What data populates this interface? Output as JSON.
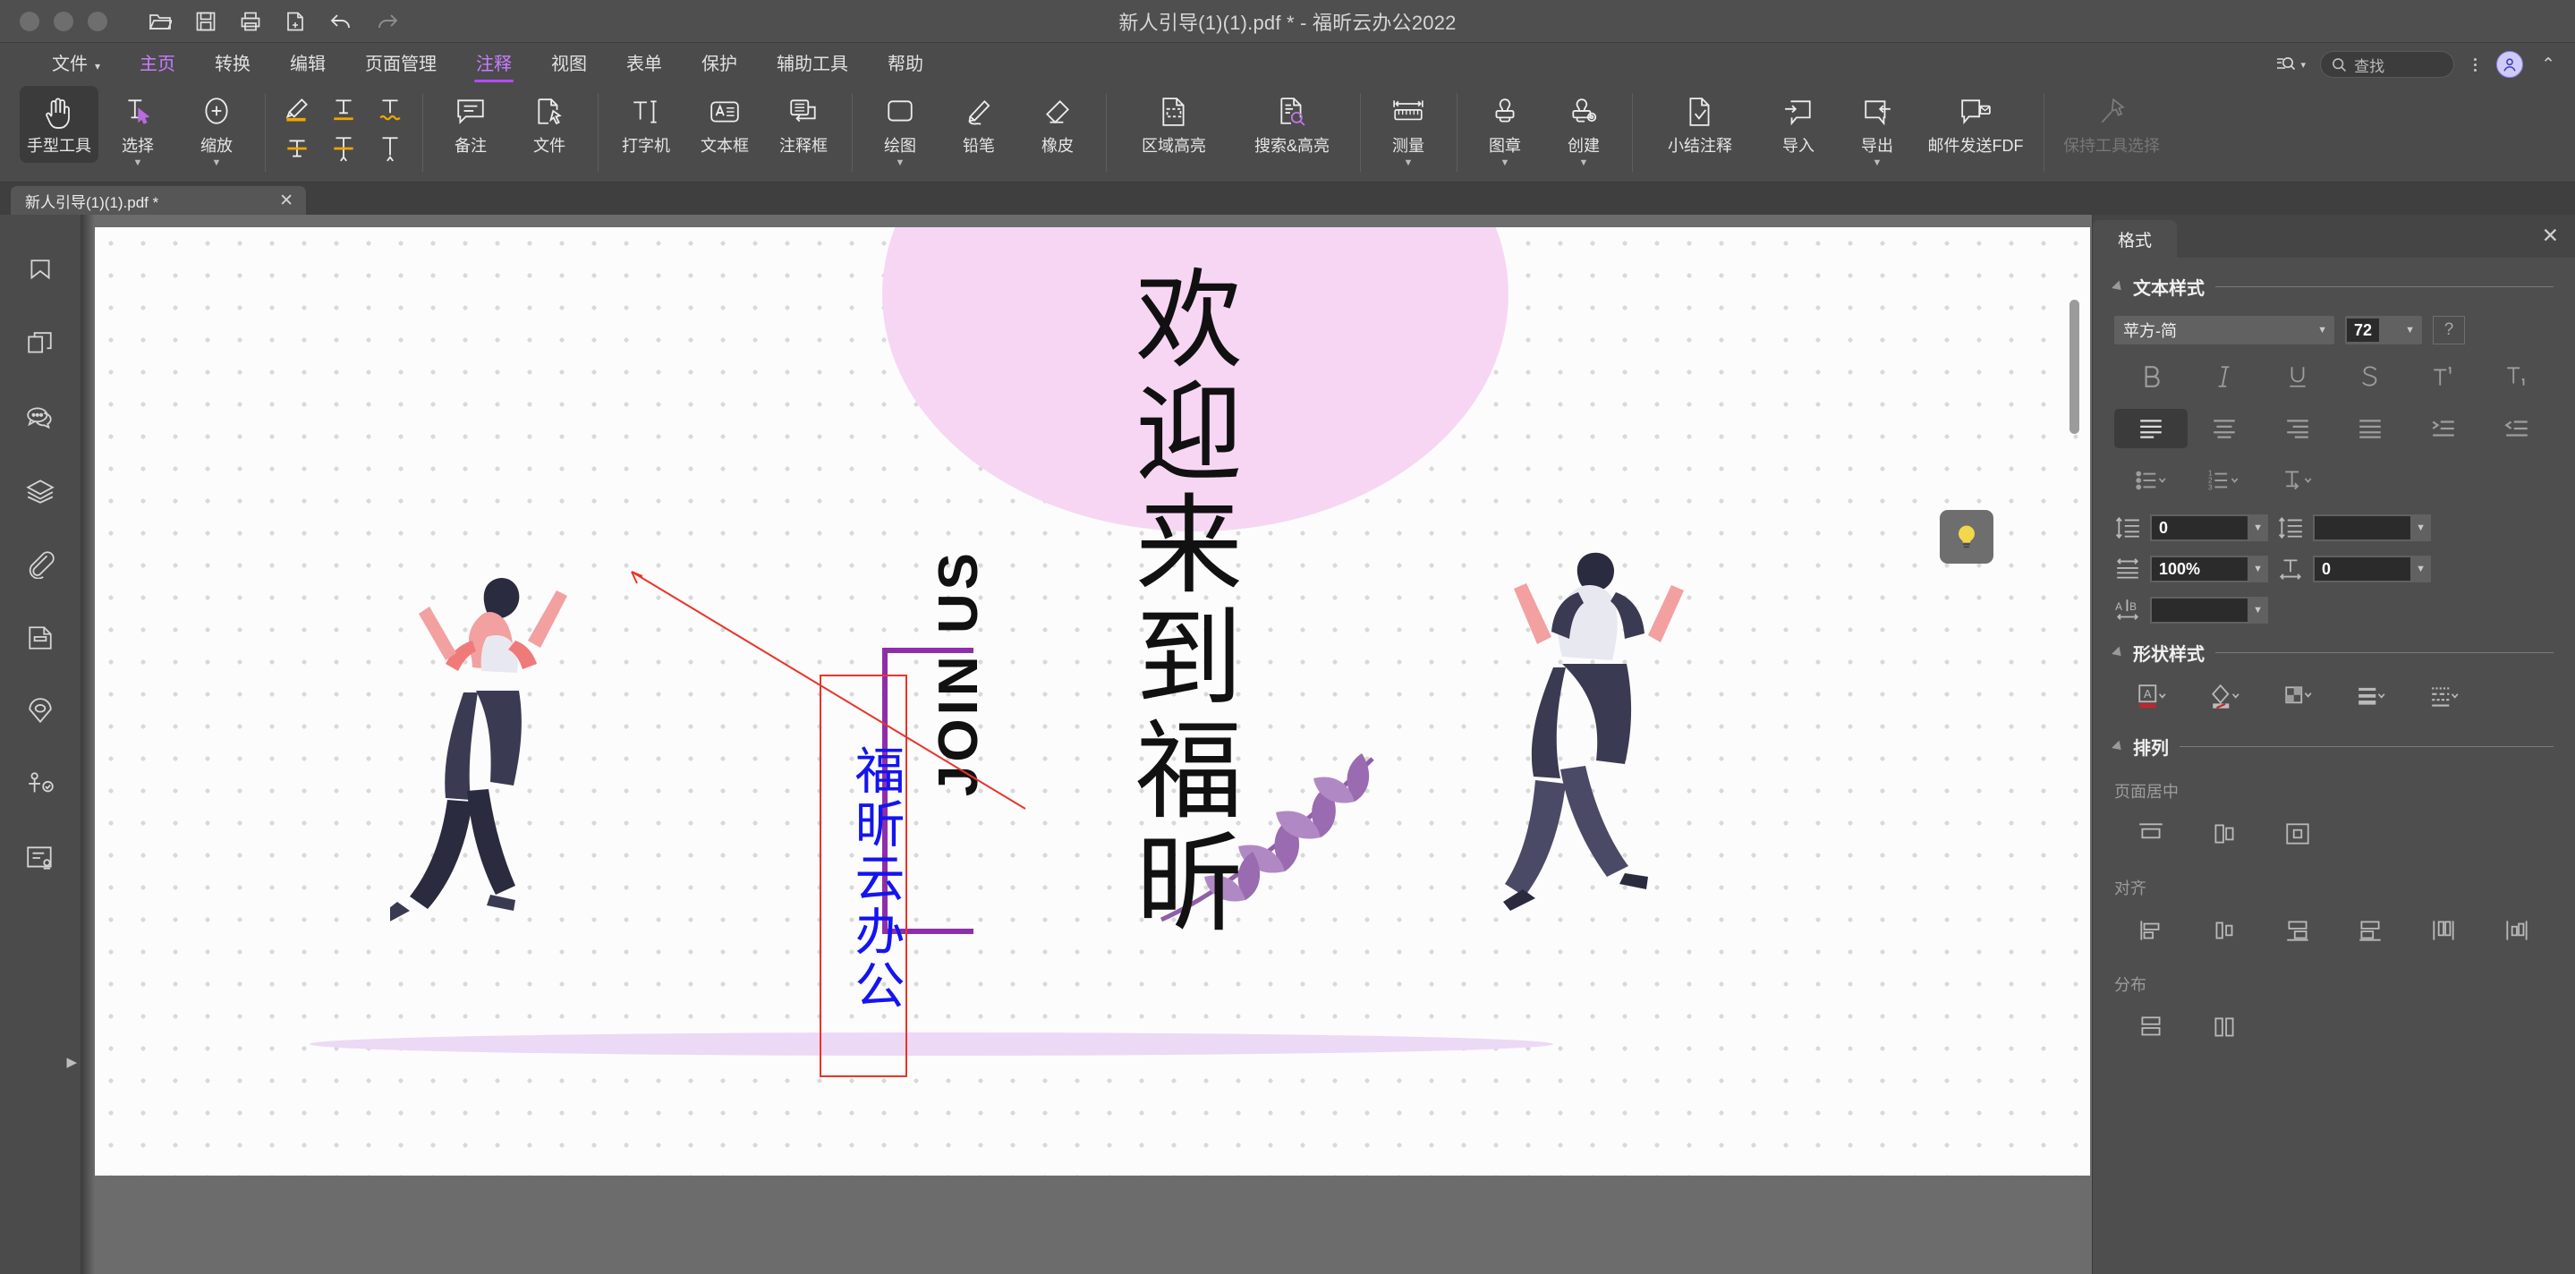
{
  "window": {
    "title": "新人引导(1)(1).pdf * - 福昕云办公2022",
    "quick_access": [
      "open-icon",
      "save-icon",
      "print-icon",
      "new-page-icon",
      "undo-icon",
      "redo-icon"
    ]
  },
  "menubar": {
    "items": [
      {
        "label": "文件",
        "has_caret": true,
        "state": "normal"
      },
      {
        "label": "主页",
        "state": "accent"
      },
      {
        "label": "转换",
        "state": "normal"
      },
      {
        "label": "编辑",
        "state": "normal"
      },
      {
        "label": "页面管理",
        "state": "normal"
      },
      {
        "label": "注释",
        "state": "active"
      },
      {
        "label": "视图",
        "state": "normal"
      },
      {
        "label": "表单",
        "state": "normal"
      },
      {
        "label": "保护",
        "state": "normal"
      },
      {
        "label": "辅助工具",
        "state": "normal"
      },
      {
        "label": "帮助",
        "state": "normal"
      }
    ],
    "search": {
      "placeholder": "查找",
      "icon": "search-icon"
    },
    "advanced_search_icon": "advanced-search-icon",
    "overflow_icon": "kebab-menu-icon",
    "account_icon": "user-avatar-icon",
    "collapse_icon": "chevron-up-icon"
  },
  "ribbon": {
    "groups": [
      {
        "name": "tools",
        "buttons": [
          {
            "label": "手型工具",
            "icon": "hand-tool-icon",
            "selected": true,
            "dropdown": false
          },
          {
            "label": "选择",
            "icon": "select-text-icon",
            "selected": false,
            "dropdown": true
          },
          {
            "label": "缩放",
            "icon": "zoom-icon",
            "selected": false,
            "dropdown": true
          }
        ]
      },
      {
        "name": "markup",
        "icons": [
          "highlight-icon",
          "underline-icon",
          "squiggly-icon",
          "strikeout-icon",
          "replace-text-icon",
          "insert-text-icon"
        ]
      },
      {
        "name": "notes",
        "buttons": [
          {
            "label": "备注",
            "icon": "note-comment-icon",
            "dropdown": false
          },
          {
            "label": "文件",
            "icon": "file-attachment-icon",
            "dropdown": false
          }
        ]
      },
      {
        "name": "text",
        "buttons": [
          {
            "label": "打字机",
            "icon": "typewriter-icon",
            "dropdown": false
          },
          {
            "label": "文本框",
            "icon": "textbox-icon",
            "dropdown": false
          },
          {
            "label": "注释框",
            "icon": "callout-icon",
            "dropdown": false
          }
        ]
      },
      {
        "name": "drawing",
        "buttons": [
          {
            "label": "绘图",
            "icon": "shape-rectangle-icon",
            "dropdown": true
          },
          {
            "label": "铅笔",
            "icon": "pencil-icon",
            "dropdown": false
          },
          {
            "label": "橡皮",
            "icon": "eraser-icon",
            "dropdown": false
          }
        ]
      },
      {
        "name": "highlight",
        "buttons": [
          {
            "label": "区域高亮",
            "icon": "area-highlight-icon",
            "dropdown": false
          },
          {
            "label": "搜索&高亮",
            "icon": "search-highlight-icon",
            "dropdown": false
          }
        ]
      },
      {
        "name": "measure",
        "buttons": [
          {
            "label": "测量",
            "icon": "measure-ruler-icon",
            "dropdown": true
          }
        ]
      },
      {
        "name": "stamp",
        "buttons": [
          {
            "label": "图章",
            "icon": "stamp-icon",
            "dropdown": true
          },
          {
            "label": "创建",
            "icon": "stamp-create-icon",
            "dropdown": true
          }
        ]
      },
      {
        "name": "manage",
        "buttons": [
          {
            "label": "小结注释",
            "icon": "summarize-comments-icon",
            "dropdown": false
          },
          {
            "label": "导入",
            "icon": "import-comments-icon",
            "dropdown": false
          },
          {
            "label": "导出",
            "icon": "export-comments-icon",
            "dropdown": true
          },
          {
            "label": "邮件发送FDF",
            "icon": "mail-fdf-icon",
            "dropdown": false
          }
        ]
      },
      {
        "name": "keep",
        "buttons": [
          {
            "label": "保持工具选择",
            "icon": "pin-tool-icon",
            "disabled": true,
            "dropdown": false
          }
        ]
      }
    ]
  },
  "tabstrip": {
    "tabs": [
      {
        "label": "新人引导(1)(1).pdf *",
        "close_icon": "close-icon",
        "active": true
      }
    ]
  },
  "sidebar": {
    "items": [
      {
        "name": "bookmark",
        "icon": "bookmark-icon"
      },
      {
        "name": "pages",
        "icon": "page-thumbnails-icon"
      },
      {
        "name": "comments",
        "icon": "comments-icon"
      },
      {
        "name": "layers",
        "icon": "layers-icon"
      },
      {
        "name": "attachments",
        "icon": "attachment-clip-icon"
      },
      {
        "name": "stamps",
        "icon": "stamp-panel-icon"
      },
      {
        "name": "locations",
        "icon": "location-pin-icon"
      },
      {
        "name": "signature",
        "icon": "digital-signature-icon"
      },
      {
        "name": "fields",
        "icon": "form-fields-icon"
      }
    ],
    "expander_icon": "expand-right-icon"
  },
  "document": {
    "page_art": {
      "headline": "欢迎来到福昕",
      "subline": "JOIN US",
      "bracket_color": "#8e2fa8",
      "blob_color": "#f7d6f4"
    },
    "annotation": {
      "text": "福昕云办公",
      "border_color": "#e8352a",
      "text_color": "#1414f0",
      "callout_color": "#e8352a"
    },
    "hint_icon": "lightbulb-icon"
  },
  "format_panel": {
    "tab_label": "格式",
    "close_icon": "close-icon",
    "sections": [
      {
        "title": "文本样式"
      },
      {
        "title": "形状样式"
      },
      {
        "title": "排列"
      }
    ],
    "text_style": {
      "font_family": "苹方-简",
      "font_size": "72",
      "help_label": "?",
      "style_buttons": [
        "bold-icon",
        "italic-icon",
        "underline-icon",
        "strikethrough-icon",
        "superscript-icon",
        "subscript-icon"
      ],
      "align_buttons": [
        "align-left-icon",
        "align-center-icon",
        "align-right-icon",
        "align-justify-icon",
        "indent-increase-icon",
        "indent-decrease-icon"
      ],
      "list_buttons": [
        "bullet-list-icon",
        "numbered-list-icon",
        "text-direction-icon"
      ],
      "line_spacing": "0",
      "paragraph_spacing": "",
      "char_scale": "100%",
      "char_spacing": "0",
      "word_spacing": ""
    },
    "shape_style": {
      "buttons": [
        "text-fill-color-icon",
        "shape-fill-color-icon",
        "opacity-icon",
        "line-weight-icon",
        "line-style-icon"
      ],
      "text_fill_swatch": "#c0272d",
      "shape_fill_swatch": "#c0272d"
    },
    "arrange": {
      "center_label": "页面居中",
      "center_buttons": [
        "center-horizontal-icon",
        "center-vertical-icon",
        "center-both-icon"
      ],
      "align_label": "对齐",
      "align_buttons": [
        "align-obj-left-icon",
        "align-obj-hcenter-icon",
        "align-obj-right-icon",
        "align-obj-top-icon",
        "align-obj-vcenter-icon",
        "align-obj-bottom-icon"
      ],
      "distribute_label": "分布",
      "distribute_buttons": [
        "distribute-vertical-icon",
        "distribute-horizontal-icon"
      ]
    }
  }
}
